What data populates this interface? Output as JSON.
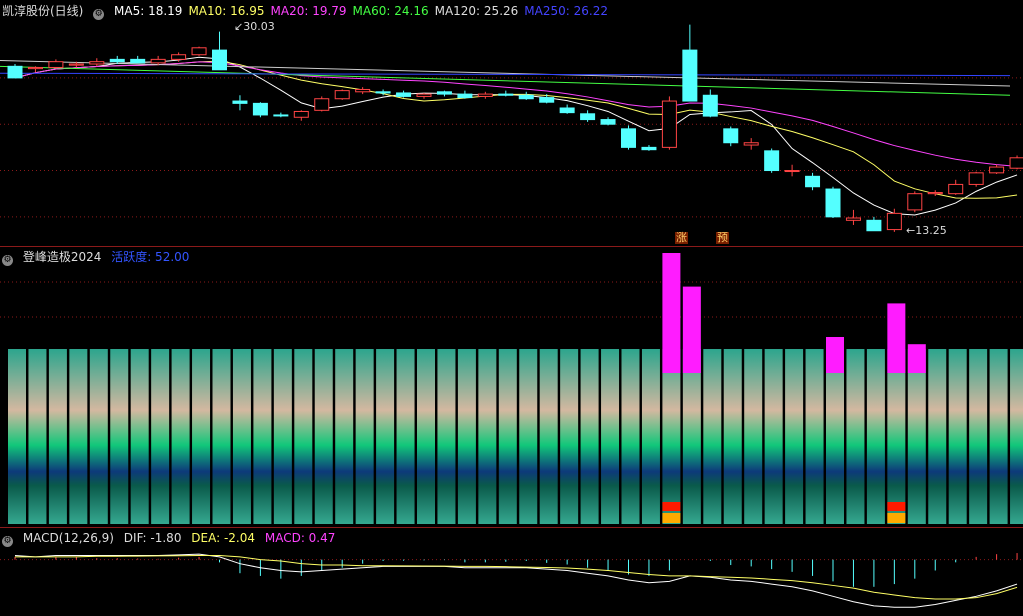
{
  "main": {
    "title": "凯淳股份(日线)",
    "ma": [
      {
        "label": "MA5: 18.19",
        "color": "#ffffff"
      },
      {
        "label": "MA10: 16.95",
        "color": "#ffff66"
      },
      {
        "label": "MA20: 19.79",
        "color": "#ff44ff"
      },
      {
        "label": "MA60: 24.16",
        "color": "#44ff44"
      },
      {
        "label": "MA120: 25.26",
        "color": "#dddddd"
      },
      {
        "label": "MA250: 26.22",
        "color": "#4444ff"
      }
    ],
    "high_label": "30.03",
    "low_label": "13.25",
    "tag1": "涨",
    "tag2": "预"
  },
  "indicator": {
    "title": "登峰造极2024",
    "value_label": "活跃度: 52.00"
  },
  "macd": {
    "title": "MACD(12,26,9)",
    "dif": "DIF: -1.80",
    "dea": "DEA: -2.04",
    "macd": "MACD: 0.47"
  },
  "chart_data": {
    "type": "candlestick",
    "price_range": [
      12.0,
      31.0
    ],
    "candles": [
      [
        27.0,
        27.2,
        26.1,
        26.0,
        "down"
      ],
      [
        26.8,
        27.0,
        26.5,
        26.9,
        "up"
      ],
      [
        26.9,
        27.6,
        26.8,
        27.4,
        "up"
      ],
      [
        27.1,
        27.4,
        26.9,
        27.2,
        "up"
      ],
      [
        27.2,
        27.7,
        27.0,
        27.4,
        "up"
      ],
      [
        27.6,
        27.9,
        27.2,
        27.4,
        "down"
      ],
      [
        27.6,
        27.9,
        27.3,
        27.3,
        "down"
      ],
      [
        27.3,
        27.9,
        27.1,
        27.6,
        "up"
      ],
      [
        27.6,
        28.2,
        27.4,
        28.0,
        "up"
      ],
      [
        28.0,
        28.7,
        27.9,
        28.6,
        "up"
      ],
      [
        28.4,
        30.0,
        26.9,
        26.7,
        "down"
      ],
      [
        24.0,
        24.5,
        23.2,
        23.8,
        "down"
      ],
      [
        23.8,
        23.9,
        22.6,
        22.8,
        "down"
      ],
      [
        22.8,
        23.0,
        22.6,
        22.8,
        "down"
      ],
      [
        22.6,
        23.2,
        22.3,
        23.1,
        "up"
      ],
      [
        23.2,
        24.4,
        23.1,
        24.2,
        "up"
      ],
      [
        24.2,
        25.0,
        24.1,
        24.9,
        "up"
      ],
      [
        25.0,
        25.2,
        24.6,
        24.8,
        "up"
      ],
      [
        24.8,
        25.0,
        24.5,
        24.7,
        "down"
      ],
      [
        24.7,
        24.9,
        24.3,
        24.4,
        "down"
      ],
      [
        24.4,
        24.7,
        24.2,
        24.6,
        "up"
      ],
      [
        24.6,
        24.9,
        24.4,
        24.8,
        "down"
      ],
      [
        24.6,
        24.9,
        24.2,
        24.3,
        "down"
      ],
      [
        24.4,
        24.8,
        24.2,
        24.6,
        "up"
      ],
      [
        24.6,
        24.9,
        24.4,
        24.5,
        "down"
      ],
      [
        24.5,
        24.8,
        24.1,
        24.2,
        "down"
      ],
      [
        24.3,
        24.6,
        23.8,
        23.9,
        "down"
      ],
      [
        23.4,
        23.7,
        22.9,
        23.0,
        "down"
      ],
      [
        22.9,
        23.2,
        22.2,
        22.4,
        "down"
      ],
      [
        22.4,
        22.6,
        21.9,
        22.0,
        "down"
      ],
      [
        21.6,
        21.9,
        19.8,
        20.0,
        "down"
      ],
      [
        20.0,
        20.2,
        19.7,
        19.8,
        "down"
      ],
      [
        20.0,
        24.4,
        19.8,
        24.0,
        "up"
      ],
      [
        24.0,
        30.6,
        24.0,
        28.4,
        "down"
      ],
      [
        24.5,
        25.0,
        22.6,
        22.7,
        "down"
      ],
      [
        21.6,
        21.8,
        20.1,
        20.4,
        "down"
      ],
      [
        20.2,
        20.8,
        19.8,
        20.4,
        "up"
      ],
      [
        19.7,
        19.9,
        17.8,
        18.0,
        "down"
      ],
      [
        18.0,
        18.5,
        17.5,
        18.0,
        "up"
      ],
      [
        17.5,
        17.8,
        16.3,
        16.6,
        "down"
      ],
      [
        16.4,
        16.6,
        13.9,
        14.0,
        "down"
      ],
      [
        13.9,
        14.6,
        13.3,
        13.7,
        "up"
      ],
      [
        13.7,
        14.0,
        12.8,
        12.8,
        "down"
      ],
      [
        12.9,
        14.7,
        12.7,
        14.3,
        "up"
      ],
      [
        14.6,
        16.2,
        14.4,
        16.0,
        "up"
      ],
      [
        16.0,
        16.3,
        15.8,
        16.1,
        "up"
      ],
      [
        16.0,
        17.2,
        15.9,
        16.8,
        "up"
      ],
      [
        16.8,
        17.9,
        16.6,
        17.8,
        "up"
      ],
      [
        17.8,
        18.5,
        17.7,
        18.3,
        "up"
      ],
      [
        18.2,
        19.3,
        18.1,
        19.1,
        "up"
      ]
    ],
    "macd_range": [
      -4.0,
      1.0
    ],
    "dif_line": [
      0.3,
      0.2,
      0.3,
      0.3,
      0.3,
      0.3,
      0.3,
      0.3,
      0.35,
      0.4,
      0.2,
      -0.3,
      -0.6,
      -0.8,
      -0.9,
      -0.8,
      -0.7,
      -0.6,
      -0.5,
      -0.5,
      -0.5,
      -0.5,
      -0.6,
      -0.6,
      -0.6,
      -0.6,
      -0.7,
      -0.8,
      -1.0,
      -1.2,
      -1.5,
      -1.7,
      -1.6,
      -1.2,
      -1.3,
      -1.5,
      -1.6,
      -1.8,
      -2.0,
      -2.3,
      -2.7,
      -3.1,
      -3.4,
      -3.5,
      -3.5,
      -3.3,
      -3.0,
      -2.7,
      -2.3,
      -1.8
    ],
    "dea_line": [
      0.2,
      0.2,
      0.2,
      0.2,
      0.25,
      0.25,
      0.26,
      0.27,
      0.28,
      0.3,
      0.3,
      0.2,
      0.0,
      -0.1,
      -0.3,
      -0.4,
      -0.4,
      -0.45,
      -0.45,
      -0.46,
      -0.47,
      -0.48,
      -0.5,
      -0.5,
      -0.52,
      -0.55,
      -0.58,
      -0.62,
      -0.7,
      -0.8,
      -0.95,
      -1.1,
      -1.2,
      -1.2,
      -1.25,
      -1.3,
      -1.35,
      -1.45,
      -1.55,
      -1.7,
      -1.9,
      -2.1,
      -2.4,
      -2.6,
      -2.8,
      -2.9,
      -2.9,
      -2.8,
      -2.5,
      -2.04
    ],
    "indicator_top": [
      0,
      0,
      0,
      0,
      0,
      0,
      0,
      0,
      0,
      0,
      0,
      0,
      0,
      0,
      0,
      0,
      0,
      0,
      0,
      0,
      0,
      0,
      0,
      0,
      0,
      0,
      0,
      0,
      0,
      0,
      0,
      0,
      100,
      72,
      0,
      0,
      0,
      0,
      0,
      0,
      30,
      0,
      0,
      58,
      24,
      0,
      0,
      0,
      0,
      0
    ]
  }
}
